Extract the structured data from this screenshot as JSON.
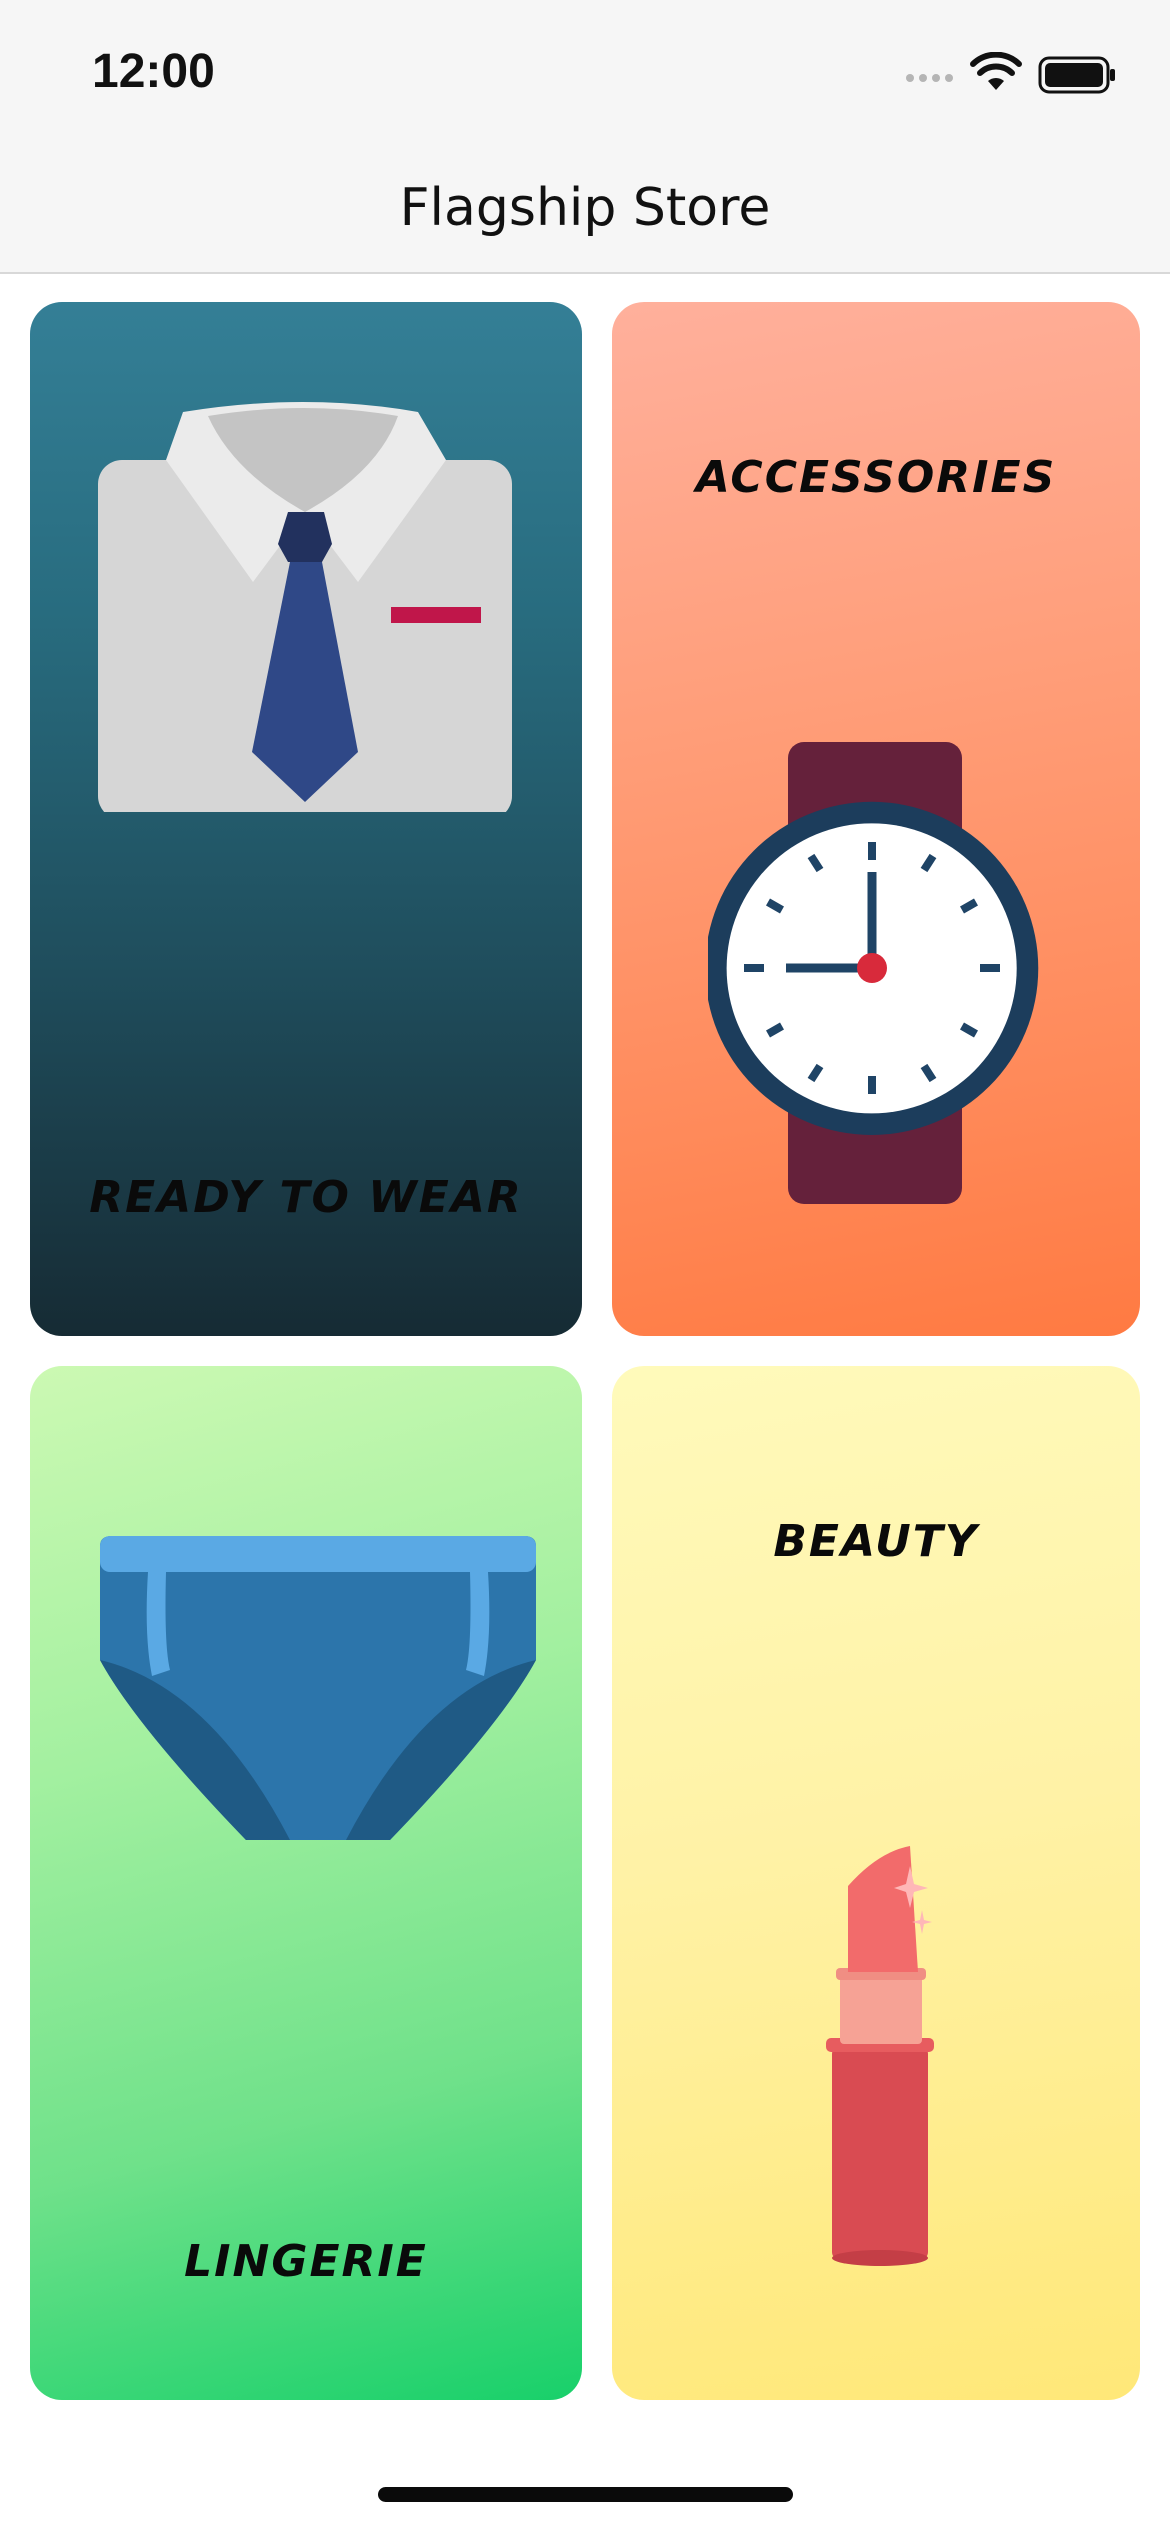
{
  "status_bar": {
    "time": "12:00"
  },
  "nav": {
    "title": "Flagship Store"
  },
  "categories": [
    {
      "label": "READY TO WEAR",
      "icon": "shirt-tie-icon"
    },
    {
      "label": "ACCESSORIES",
      "icon": "wristwatch-icon"
    },
    {
      "label": "LINGERIE",
      "icon": "underwear-icon"
    },
    {
      "label": "BEAUTY",
      "icon": "lipstick-icon"
    }
  ],
  "colors": {
    "ready_to_wear_gradient": [
      "#347f96",
      "#162b34"
    ],
    "accessories_gradient": [
      "#ffb09c",
      "#ff7a42"
    ],
    "lingerie_gradient": [
      "#ccf9b3",
      "#18d06a"
    ],
    "beauty_gradient": [
      "#fffabb",
      "#ffe878"
    ]
  }
}
